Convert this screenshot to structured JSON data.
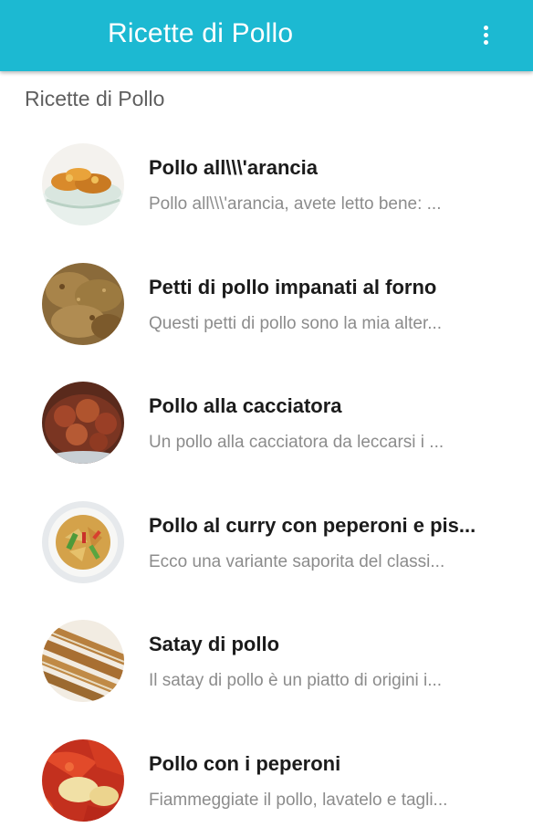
{
  "appbar": {
    "title": "Ricette di Pollo",
    "menu_icon": "more-vert-icon",
    "color": "#1cb9d2"
  },
  "section": {
    "title": "Ricette di Pollo"
  },
  "recipes": [
    {
      "title": "Pollo all\\\\\\'arancia",
      "description": "Pollo all\\\\\\'arancia, avete letto bene: ...",
      "image": "orange-chicken-photo"
    },
    {
      "title": "Petti di pollo impanati al forno",
      "description": "Questi petti di pollo sono la mia alter...",
      "image": "breaded-chicken-photo"
    },
    {
      "title": "Pollo alla cacciatora",
      "description": "Un pollo alla cacciatora da leccarsi i ...",
      "image": "chicken-cacciatore-photo"
    },
    {
      "title": "Pollo al curry con peperoni e pis...",
      "description": "Ecco una variante saporita del classi...",
      "image": "chicken-curry-photo"
    },
    {
      "title": "Satay di pollo",
      "description": "Il satay di pollo è un piatto di origini i...",
      "image": "chicken-satay-photo"
    },
    {
      "title": "Pollo con i peperoni",
      "description": "Fiammeggiate il pollo, lavatelo e tagli...",
      "image": "chicken-peppers-photo"
    }
  ]
}
